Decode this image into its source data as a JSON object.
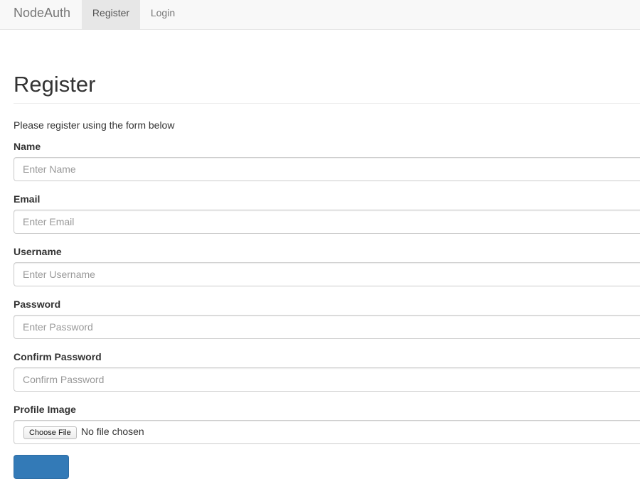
{
  "navbar": {
    "brand": "NodeAuth",
    "items": [
      {
        "label": "Register",
        "active": true
      },
      {
        "label": "Login",
        "active": false
      }
    ]
  },
  "page": {
    "title": "Register",
    "intro": "Please register using the form below"
  },
  "form": {
    "name": {
      "label": "Name",
      "placeholder": "Enter Name",
      "value": ""
    },
    "email": {
      "label": "Email",
      "placeholder": "Enter Email",
      "value": ""
    },
    "username": {
      "label": "Username",
      "placeholder": "Enter Username",
      "value": ""
    },
    "password": {
      "label": "Password",
      "placeholder": "Enter Password",
      "value": ""
    },
    "confirm_password": {
      "label": "Confirm Password",
      "placeholder": "Confirm Password",
      "value": ""
    },
    "profile_image": {
      "label": "Profile Image",
      "button_label": "Choose File",
      "status": "No file chosen"
    },
    "submit_color": "#337ab7"
  },
  "colors": {
    "navbar_bg": "#f8f8f8",
    "active_tab_bg": "#e7e7e7",
    "primary": "#337ab7"
  }
}
